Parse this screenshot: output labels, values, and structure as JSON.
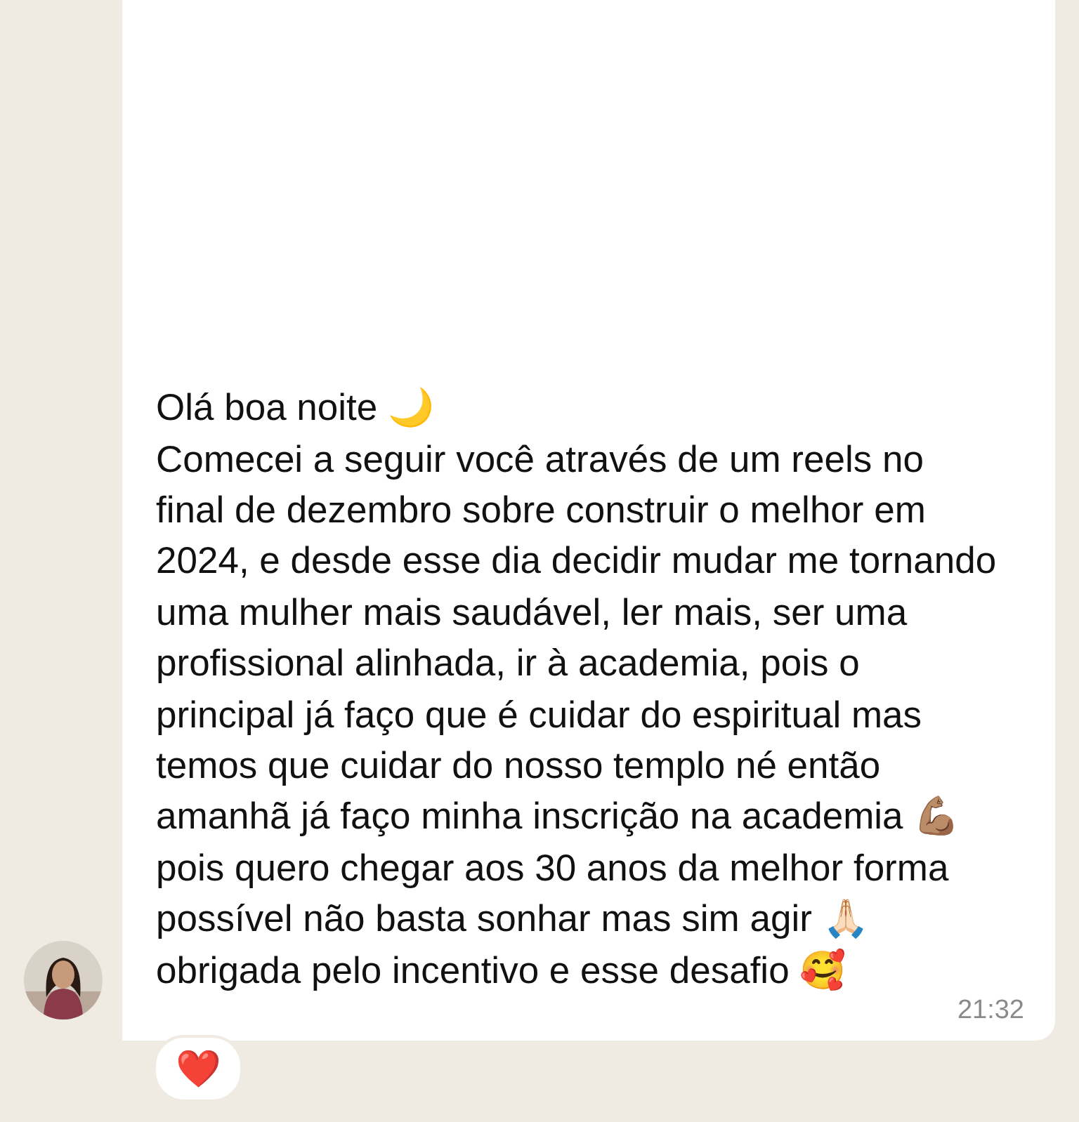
{
  "message": {
    "text": "Olá boa noite 🌙\nComecei a seguir você através de um reels no final de dezembro sobre construir o melhor em 2024, e desde esse dia decidir mudar me tornando uma mulher mais saudável, ler mais, ser uma profissional alinhada, ir à academia, pois o principal já faço que é cuidar do espiritual mas temos que cuidar do nosso templo né então amanhã já faço minha inscrição na academia 💪🏽 pois quero chegar aos 30 anos da melhor forma possível não basta sonhar mas sim agir 🙏🏻\nobrigada pelo incentivo e esse desafio 🥰",
    "time": "21:32",
    "reaction": "❤️"
  }
}
